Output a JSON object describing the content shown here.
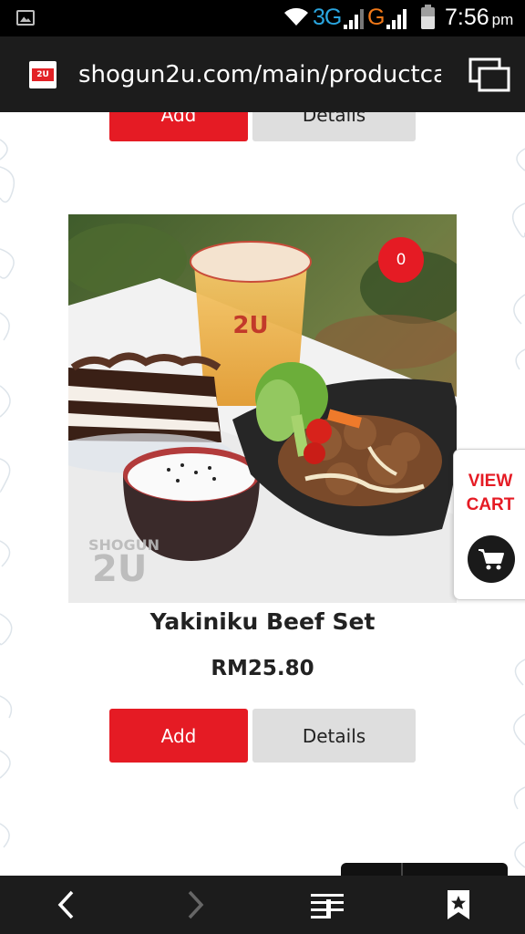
{
  "status_bar": {
    "network_primary": "3G",
    "network_secondary": "G",
    "time": "7:56",
    "ampm": "pm"
  },
  "url_bar": {
    "favicon_text": "2U",
    "url": "shogun2u.com/main/productca"
  },
  "top_product": {
    "add_label": "Add",
    "details_label": "Details"
  },
  "product": {
    "name": "Yakiniku Beef Set",
    "price": "RM25.80",
    "quantity": "0",
    "watermark": "SHOGUN 2U",
    "add_label": "Add",
    "details_label": "Details"
  },
  "view_cart": {
    "line1": "VIEW",
    "line2": "CART"
  },
  "colors": {
    "accent": "#e51b24",
    "secondary_button": "#dedede",
    "system_bar": "#1c1c1c"
  },
  "icons": {
    "nav_back": "chevron-left-icon",
    "nav_forward": "chevron-right-icon",
    "reader": "reader-mode-icon",
    "bookmark": "bookmark-star-icon",
    "tabs": "tabs-icon",
    "cart": "shopping-cart-icon"
  }
}
